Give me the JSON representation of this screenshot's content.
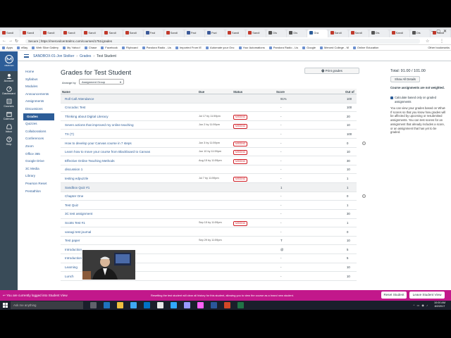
{
  "browser": {
    "tabs": [
      {
        "label": "Sandi",
        "color": "#c0392b"
      },
      {
        "label": "Sandi",
        "color": "#c0392b"
      },
      {
        "label": "Sandi",
        "color": "#c0392b"
      },
      {
        "label": "Sandi",
        "color": "#c0392b"
      },
      {
        "label": "Sandi",
        "color": "#c0392b"
      },
      {
        "label": "Sandi",
        "color": "#c0392b"
      },
      {
        "label": "Sandi",
        "color": "#c0392b"
      },
      {
        "label": "Fwd",
        "color": "#3b5998"
      },
      {
        "label": "Sandi",
        "color": "#c0392b"
      },
      {
        "label": "Fwd",
        "color": "#3b5998"
      },
      {
        "label": "Fwd",
        "color": "#3b5998"
      },
      {
        "label": "Sandi",
        "color": "#c0392b"
      },
      {
        "label": "Sandi",
        "color": "#c0392b"
      },
      {
        "label": "Dis",
        "color": "#555555"
      },
      {
        "label": "Dis",
        "color": "#555555"
      },
      {
        "label": "Gra",
        "color": "#2d5d98",
        "active": true
      },
      {
        "label": "Sandi",
        "color": "#c0392b"
      },
      {
        "label": "Sandi",
        "color": "#c0392b"
      },
      {
        "label": "Dis",
        "color": "#555555"
      },
      {
        "label": "Sandi",
        "color": "#c0392b"
      },
      {
        "label": "Dis",
        "color": "#555555"
      },
      {
        "label": "Sandi",
        "color": "#c0392b"
      }
    ],
    "url": "Secure  |  https://mercedcentralmc.com/courses/1751/grades",
    "bookmarks": [
      "Apps",
      "eBay",
      "Web Slice Gallery",
      "My Yahoo!",
      "Chase",
      "Facebook",
      "Flipboard",
      "Pandora Radio - Lis",
      "Imported From IE",
      "Automate your Onc",
      "Your Automations",
      "Pandora Radio - Lis",
      "Google",
      "Merced College - M",
      "Online Education"
    ],
    "bookmarks_other": "Other bookmarks"
  },
  "global_nav": [
    {
      "label": "Account",
      "icon": "account-icon"
    },
    {
      "label": "Dashboard",
      "icon": "dashboard-icon"
    },
    {
      "label": "Courses",
      "icon": "courses-icon"
    },
    {
      "label": "Calendar",
      "icon": "calendar-icon"
    },
    {
      "label": "Inbox",
      "icon": "inbox-icon"
    },
    {
      "label": "Help",
      "icon": "help-icon"
    }
  ],
  "logo_text": "MERCED COLLEGE",
  "breadcrumb": {
    "course": "SANDBOX-01-Jon Stolker",
    "section": "Grades",
    "current": "Test Student"
  },
  "course_nav": [
    "Home",
    "Syllabus",
    "Modules",
    "Announcements",
    "Assignments",
    "Discussions",
    "Grades",
    "Quizzes",
    "Collaborations",
    "Conferences",
    "Zoom",
    "Office 365",
    "Google Drive",
    "3C Media",
    "Library",
    "Pearson Reset",
    "Pentathlon"
  ],
  "course_nav_active": "Grades",
  "page_title": "Grades for Test Student",
  "print_label": "Print grades",
  "arrange_label": "Arrange by",
  "arrange_value": "Assignment Group",
  "table": {
    "headers": {
      "name": "Name",
      "due": "Due",
      "status": "Status",
      "score": "Score",
      "out_of": "Out of"
    },
    "rows": [
      {
        "name": "Roll Call Attendance",
        "due": "",
        "status": "",
        "score": "91%",
        "out_of": "100",
        "alt": true
      },
      {
        "name": "Crocodoc Test",
        "due": "",
        "status": "",
        "score": "-",
        "out_of": "100"
      },
      {
        "name": "Thinking about Digital Literacy",
        "due": "Jul 17 by 11:59pm",
        "status": "MISSING",
        "score": "-",
        "out_of": "20"
      },
      {
        "name": "Seven actions that improved my online teaching",
        "due": "Jun 2 by 11:59pm",
        "status": "MISSING",
        "score": "-",
        "out_of": "10"
      },
      {
        "name": "TX (T)",
        "due": "",
        "status": "",
        "score": "-",
        "out_of": "100"
      },
      {
        "name": "How to develop your Canvas course in 7 steps",
        "due": "Jun 3 by 11:59pm",
        "status": "MISSING",
        "score": "-",
        "out_of": "0",
        "icon": true
      },
      {
        "name": "Learn how to move your course from Blackboard to Canvas",
        "due": "Jun 10 by 11:59pm",
        "status": "MISSING",
        "score": "-",
        "out_of": "10"
      },
      {
        "name": "Effective Online Teaching Methods",
        "due": "Aug 15 by 11:59pm",
        "status": "MISSING",
        "score": "-",
        "out_of": "30"
      },
      {
        "name": "discussion 1",
        "due": "",
        "status": "",
        "score": "-",
        "out_of": "10"
      },
      {
        "name": "testing edpuzzle",
        "due": "Jul 7 by 11:59pm",
        "status": "MISSING",
        "score": "-",
        "out_of": "1"
      },
      {
        "name": "Sandbox Quiz #1",
        "due": "",
        "status": "",
        "score": "1",
        "out_of": "1",
        "alt": true
      },
      {
        "name": "Chapter One",
        "due": "",
        "status": "",
        "score": "-",
        "out_of": "0",
        "icon": true
      },
      {
        "name": "Test Quiz",
        "due": "",
        "status": "",
        "score": "-",
        "out_of": "1"
      },
      {
        "name": "3C test assignment",
        "due": "",
        "status": "",
        "score": "-",
        "out_of": "30"
      },
      {
        "name": "Scotts Test #1",
        "due": "Sep 15 by 11:59pm",
        "status": "MISSING",
        "score": "-",
        "out_of": "1"
      },
      {
        "name": "vanagi test journal",
        "due": "",
        "status": "",
        "score": "-",
        "out_of": "0"
      },
      {
        "name": "Test paper",
        "due": "Sep 29 by 11:59pm",
        "status": "",
        "score": "T",
        "out_of": "10"
      },
      {
        "name": "Introduction",
        "due": "",
        "status": "",
        "score": "@",
        "out_of": "5"
      },
      {
        "name": "Introduction",
        "due": "",
        "status": "",
        "score": "-",
        "out_of": "5"
      },
      {
        "name": "Learning",
        "due": "",
        "status": "",
        "score": "-",
        "out_of": "10"
      },
      {
        "name": "Lunch",
        "due": "",
        "status": "",
        "score": "-",
        "out_of": "10"
      }
    ]
  },
  "sidebar": {
    "total": "Total: 91.00 / 101.00",
    "details_label": "Show All Details",
    "weighted_note": "Course assignments are not weighted.",
    "calc_label": "Calculate based only on graded assignments",
    "whatif_text": "You can view your grades based on What-If scores so that you know how grades will be affected by upcoming or resubmitted assignments. You can test scores for an assignment that already includes a score, or an assignment that has yet to be graded."
  },
  "banner": {
    "left": "You are currently logged into Student View",
    "middle": "Resetting the test student will clear all history for this student, allowing you to view the course as a brand new student.",
    "reset_label": "Reset Student",
    "leave_label": "Leave Student View"
  },
  "taskbar": {
    "search_placeholder": "Ask me anything",
    "time": "10:00 AM",
    "date": "8/2/2017"
  },
  "colors": {
    "canvas_blue": "#2d5d98",
    "nav_dark": "#394b58",
    "missing_red": "#cf1c24",
    "student_banner": "#c2188b"
  }
}
